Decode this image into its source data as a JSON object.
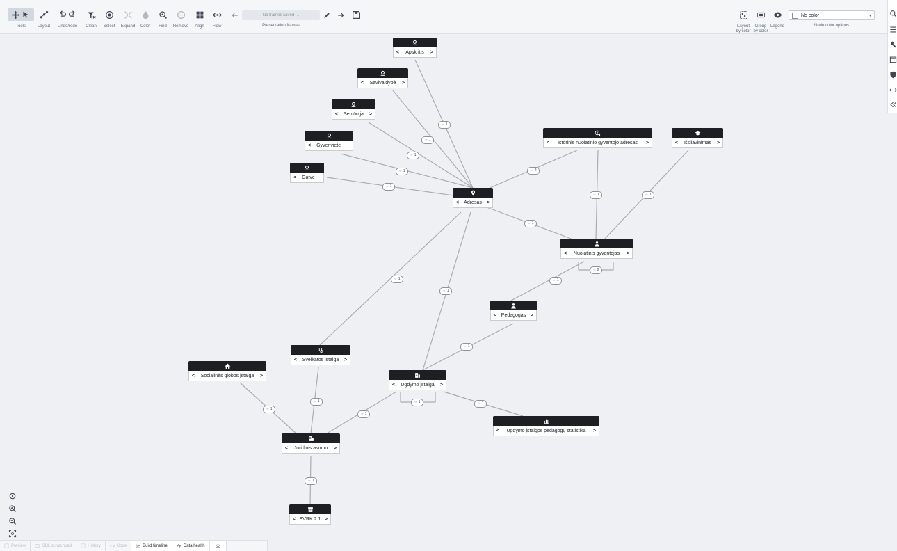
{
  "toolbar": {
    "tools_label": "Tools",
    "layout_label": "Layout",
    "undo_redo_label": "Undo/redo",
    "clean_label": "Clean",
    "select_label": "Select",
    "expand_label": "Expand",
    "color_label": "Color",
    "find_label": "Find",
    "remove_label": "Remove",
    "align_label": "Align",
    "flow_label": "Flow",
    "frames_value": "No frames saved",
    "frames_label": "Presentation frames",
    "layout_by_color_label": "Layout\nby color",
    "group_by_color_label": "Group\nby color",
    "legend_label": "Legend",
    "node_color_value": "No color",
    "node_color_label": "Node color options"
  },
  "nodes": {
    "apskritis": {
      "label": "Apskritis",
      "icon": "location-pin-icon"
    },
    "savivaldybe": {
      "label": "Savivaldybė",
      "icon": "location-pin-icon"
    },
    "seniunija": {
      "label": "Seniūnija",
      "icon": "location-pin-icon"
    },
    "gyvenviete": {
      "label": "Gyvenvietė",
      "icon": "location-pin-icon"
    },
    "gatve": {
      "label": "Gatvė",
      "icon": "location-pin-icon"
    },
    "adresas": {
      "label": "Adresas",
      "icon": "map-marker-icon"
    },
    "istorinis": {
      "label": "Istorinis nuolatinio gyventojo adresas",
      "icon": "history-location-icon"
    },
    "issilavinimas": {
      "label": "Išsilavinimas",
      "icon": "graduation-cap-icon"
    },
    "gyventojas": {
      "label": "Nuolatinis gyventojas",
      "icon": "person-icon"
    },
    "pedagogas": {
      "label": "Pedagogas",
      "icon": "person-icon"
    },
    "sveikatos": {
      "label": "Sveikatos įstaiga",
      "icon": "stethoscope-icon"
    },
    "socialines": {
      "label": "Socialinės globos įstaiga",
      "icon": "home-icon"
    },
    "ugdymo": {
      "label": "Ugdymo įstaiga",
      "icon": "building-icon"
    },
    "statistika": {
      "label": "Ugdymo įstaigos pedagogų statistika",
      "icon": "bar-chart-icon"
    },
    "juridinis": {
      "label": "Juridinis asmuo",
      "icon": "building-icon"
    },
    "evrk": {
      "label": "EVRK 2.1",
      "icon": "archive-icon"
    }
  },
  "edges": {
    "apskritis_adresas": "⇔ 1",
    "savivaldybe_adresas": "⇔ 1",
    "seniunija_adresas": "⇔ 1",
    "gyvenviete_adresas": "⇔ 1",
    "gatve_adresas": "⇔ 1",
    "istorinis_adresas": "⇔ 2",
    "istorinis_gyventojas": "⇔ 1",
    "issilavinimas_gyventojas": "⇔ 1",
    "adresas_gyventojas": "⇔ 1",
    "gyventojas_self": "⇔ 2",
    "gyventojas_pedagogas": "⇔ 1",
    "adresas_sveikatos": "⇔ 1",
    "adresas_ugdymo": "⇔ 1",
    "pedagogas_ugdymo": "⇔ 1",
    "ugdymo_self": "⇔ 1",
    "ugdymo_statistika": "⇔ 1",
    "socialines_juridinis": "⇔ 1",
    "sveikatos_juridinis": "⇔ 1",
    "ugdymo_juridinis": "⇔ 1",
    "juridinis_evrk": "⇔ 1"
  },
  "bottom_tabs": [
    {
      "label": "Preview",
      "enabled": false
    },
    {
      "label": "SQL scratchpad",
      "enabled": false
    },
    {
      "label": "History",
      "enabled": false
    },
    {
      "label": "Code",
      "enabled": false
    },
    {
      "label": "Build timeline",
      "enabled": true
    },
    {
      "label": "Data health",
      "enabled": true
    }
  ],
  "colors": {
    "node_header": "#1d1f23",
    "canvas": "#eef0f3",
    "edge": "#a7adb4"
  }
}
